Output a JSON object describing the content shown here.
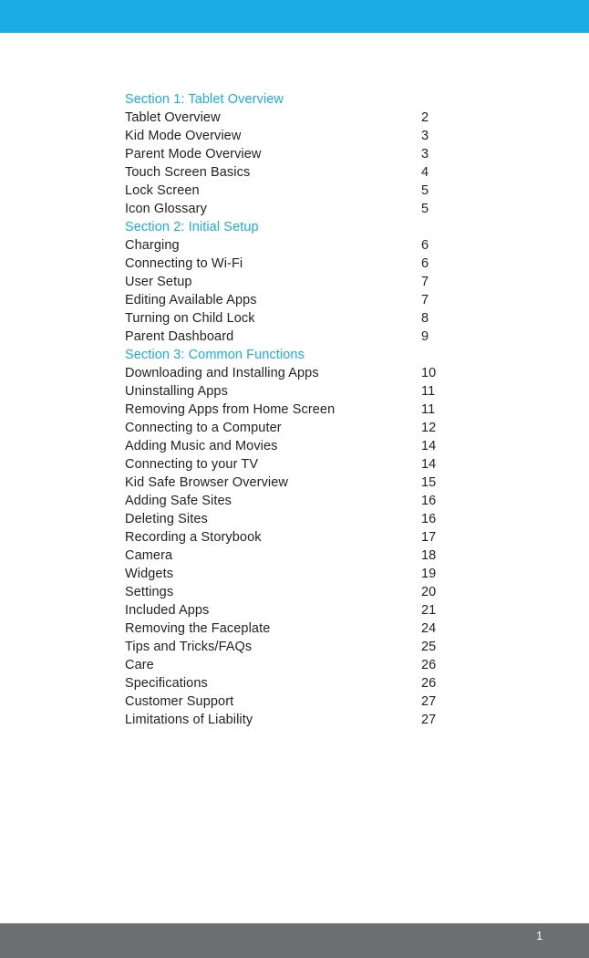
{
  "colors": {
    "accent": "#1BACE3",
    "body_text": "#231F20",
    "footer_bar": "#6D6E70",
    "footer_text": "#FFFFFF",
    "page_background": "#FFFFFF"
  },
  "footer": {
    "page_number": "1"
  },
  "toc": {
    "rows": [
      {
        "title": "Section 1: Tablet Overview",
        "page": "",
        "type": "section"
      },
      {
        "title": "Tablet Overview",
        "page": "2",
        "type": "entry"
      },
      {
        "title": "Kid Mode Overview",
        "page": "3",
        "type": "entry"
      },
      {
        "title": "Parent Mode Overview",
        "page": "3",
        "type": "entry"
      },
      {
        "title": "Touch Screen Basics",
        "page": "4",
        "type": "entry"
      },
      {
        "title": "Lock Screen",
        "page": "5",
        "type": "entry"
      },
      {
        "title": "Icon Glossary",
        "page": "5",
        "type": "entry"
      },
      {
        "title": "Section 2: Initial Setup",
        "page": "",
        "type": "section"
      },
      {
        "title": "Charging",
        "page": "6",
        "type": "entry"
      },
      {
        "title": "Connecting to Wi-Fi",
        "page": "6",
        "type": "entry"
      },
      {
        "title": "User Setup",
        "page": "7",
        "type": "entry"
      },
      {
        "title": "Editing Available Apps",
        "page": "7",
        "type": "entry"
      },
      {
        "title": "Turning on Child Lock",
        "page": "8",
        "type": "entry"
      },
      {
        "title": "Parent Dashboard",
        "page": "9",
        "type": "entry"
      },
      {
        "title": "Section 3: Common Functions",
        "page": "",
        "type": "section"
      },
      {
        "title": "Downloading and Installing Apps",
        "page": "10",
        "type": "entry"
      },
      {
        "title": "Uninstalling Apps",
        "page": "11",
        "type": "entry"
      },
      {
        "title": "Removing Apps from Home Screen",
        "page": "11",
        "type": "entry"
      },
      {
        "title": "Connecting to a Computer",
        "page": "12",
        "type": "entry"
      },
      {
        "title": "Adding Music and Movies",
        "page": "14",
        "type": "entry"
      },
      {
        "title": "Connecting to your TV",
        "page": "14",
        "type": "entry"
      },
      {
        "title": "Kid Safe Browser Overview",
        "page": "15",
        "type": "entry"
      },
      {
        "title": "Adding Safe Sites",
        "page": "16",
        "type": "entry"
      },
      {
        "title": "Deleting Sites",
        "page": "16",
        "type": "entry"
      },
      {
        "title": "Recording a Storybook",
        "page": "17",
        "type": "entry"
      },
      {
        "title": "Camera",
        "page": "18",
        "type": "entry"
      },
      {
        "title": "Widgets",
        "page": "19",
        "type": "entry"
      },
      {
        "title": "Settings",
        "page": "20",
        "type": "entry"
      },
      {
        "title": "Included Apps",
        "page": "21",
        "type": "entry"
      },
      {
        "title": "Removing the Faceplate",
        "page": "24",
        "type": "entry"
      },
      {
        "title": "Tips and Tricks/FAQs",
        "page": "25",
        "type": "entry"
      },
      {
        "title": "Care",
        "page": "26",
        "type": "entry"
      },
      {
        "title": "Specifications",
        "page": "26",
        "type": "entry"
      },
      {
        "title": "Customer Support",
        "page": "27",
        "type": "entry"
      },
      {
        "title": "Limitations of Liability",
        "page": "27",
        "type": "entry"
      }
    ]
  }
}
